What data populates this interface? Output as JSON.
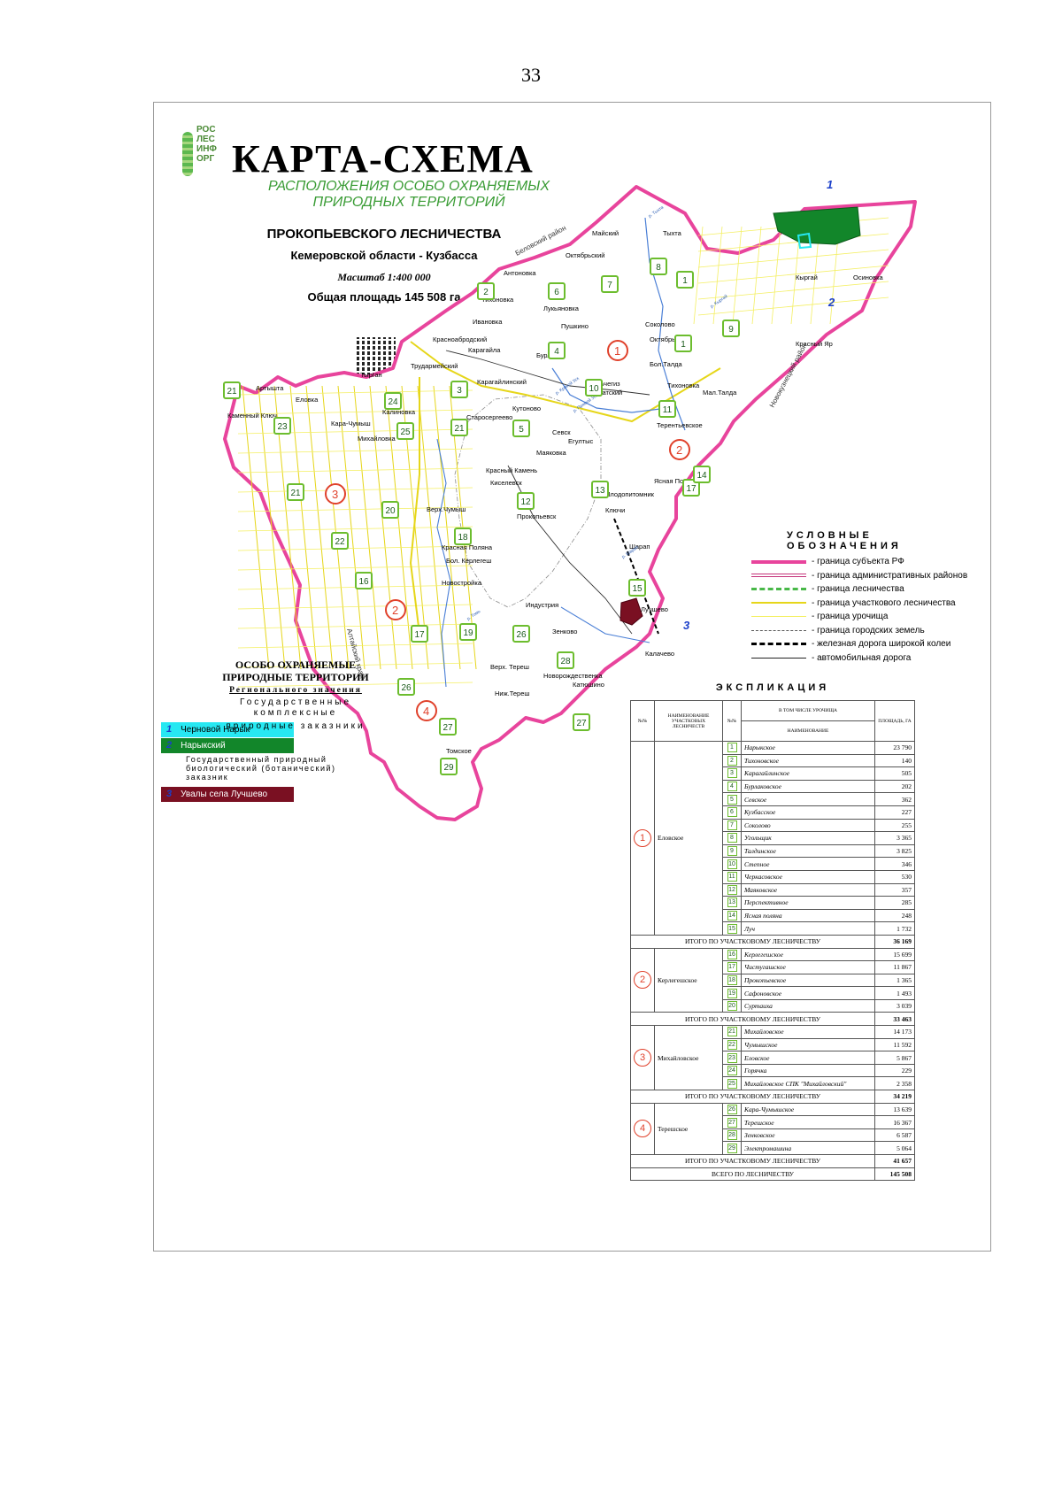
{
  "page_number": "33",
  "header": {
    "logo_text": [
      "РОС",
      "ЛЕС",
      "ИНФ",
      "ОРГ"
    ],
    "title": "КАРТА-СХЕМА",
    "subtitle_line1": "РАСПОЛОЖЕНИЯ ОСОБО ОХРАНЯЕМЫХ",
    "subtitle_line2": "ПРИРОДНЫХ ТЕРРИТОРИЙ",
    "forestry": "ПРОКОПЬЕВСКОГО ЛЕСНИЧЕСТВА",
    "region": "Кемеровской области - Кузбасса",
    "scale": "Масштаб 1:400 000",
    "total_area": "Общая площадь 145 508 га"
  },
  "colors": {
    "subject_border": "#e8449c",
    "district_border": "#c4327a",
    "forestry_border": "#48b848",
    "section_border": "#e6d61a",
    "tract_border": "#f4ef62",
    "green_label": "#6cbd2e",
    "orange_label": "#e0412b",
    "pa_cyan": "#27e8f2",
    "pa_green": "#12862a",
    "pa_maroon": "#7a1022",
    "protected_number": "#1b3fc9"
  },
  "map": {
    "place_names": [
      "Тыхта",
      "Майский",
      "Октябрьский",
      "Антоновка",
      "Тихоновка",
      "Лукьяновка",
      "Ивановка",
      "Пушкино",
      "Соколово",
      "Октябрь",
      "Кыргай",
      "Осиновка",
      "Красный Яр",
      "Бол.Талда",
      "Мал.Талда",
      "Тихоновка",
      "Красноабродский",
      "Карагайла",
      "Бурлаки",
      "Трудармейский",
      "Карагайлинский",
      "Кольчегиз",
      "Тырган",
      "Артышта",
      "Еловка",
      "Каменный Ключ",
      "Калиновка",
      "Кара-Чумыш",
      "Михайловка",
      "Старосергеево",
      "Кутоново",
      "Ускатский",
      "Терентьевское",
      "Егултыс",
      "Севск",
      "Красный Камень",
      "Маяковка",
      "Киселевск",
      "Прокопьевск",
      "Ясная Поляна",
      "Плодопитомник",
      "Ключи",
      "Верх.Чумыш",
      "Красная Поляна",
      "Бол. Керлегеш",
      "Новостройка",
      "Шарап",
      "Лучшево",
      "Индустрия",
      "Зенково",
      "Калачево",
      "Верх. Тереш",
      "Ниж.Тереш",
      "Новорождественка",
      "Катюшино",
      "Томское"
    ],
    "district_labels": [
      "Беловский район",
      "Новокузнецкий район",
      "Алтайский край"
    ],
    "rivers": [
      "р. Томь",
      "р. Кривой Уск",
      "р. Прямой Уск",
      "р. Тыхта",
      "р. Кыргай",
      "р. Шарап"
    ],
    "section_badges": [
      "1",
      "2",
      "3",
      "4"
    ],
    "tract_badges": [
      "1",
      "2",
      "3",
      "4",
      "5",
      "6",
      "7",
      "8",
      "9",
      "10",
      "11",
      "12",
      "13",
      "14",
      "15",
      "16",
      "17",
      "18",
      "19",
      "20",
      "21",
      "22",
      "23",
      "24",
      "25",
      "26",
      "27",
      "28",
      "29"
    ],
    "protected_marks": [
      "1",
      "2",
      "3"
    ]
  },
  "legend": {
    "heading": "УСЛОВНЫЕ ОБОЗНАЧЕНИЯ",
    "items": [
      {
        "label": "- граница субъекта РФ",
        "color": "#e8449c",
        "style": "thick"
      },
      {
        "label": "- граница административных районов",
        "color": "#c4327a",
        "style": "double"
      },
      {
        "label": "- граница лесничества",
        "color": "#48b848",
        "style": "dash"
      },
      {
        "label": "- граница участкового лесничества",
        "color": "#e6d61a",
        "style": "solid"
      },
      {
        "label": "- граница урочища",
        "color": "#f4ef62",
        "style": "thin"
      },
      {
        "label": "- граница городских земель",
        "color": "#555555",
        "style": "dashdot"
      },
      {
        "label": "- железная дорога широкой колеи",
        "color": "#000000",
        "style": "rail"
      },
      {
        "label": "- автомобильная дорога",
        "color": "#222222",
        "style": "road"
      }
    ]
  },
  "protected_areas": {
    "heading_line1": "ОСОБО ОХРАНЯЕМЫЕ",
    "heading_line2": "ПРИРОДНЫЕ ТЕРРИТОРИИ",
    "level": "Регионального значения",
    "category_line1": "Государственные комплексные",
    "category_line2": "природные заказники",
    "items": [
      {
        "num": "1",
        "name": "Черновой Нарык",
        "color": "#27e8f2"
      },
      {
        "num": "2",
        "name": "Нарыкский",
        "color": "#12862a"
      },
      {
        "num": "3",
        "name": "Увалы села Лучшево",
        "color": "#7a1022"
      }
    ],
    "note_line1": "Государственный природный",
    "note_line2": "биологический (ботанический)",
    "note_line3": "заказник"
  },
  "explication": {
    "heading": "ЭКСПЛИКАЦИЯ",
    "headers": {
      "num": "№№",
      "section_name": "НАИМЕНОВАНИЕ УЧАСТКОВЫХ ЛЕСНИЧЕСТВ",
      "num2": "№№",
      "including": "В ТОМ ЧИСЛЕ УРОЧИЩА",
      "tract_name": "НАИМЕНОВАНИЕ",
      "area": "ПЛОЩАДЬ, ГА"
    },
    "sections": [
      {
        "num": "1",
        "name": "Еловское",
        "tracts": [
          {
            "n": "1",
            "name": "Нарыкское",
            "area": "23 790"
          },
          {
            "n": "2",
            "name": "Тихоновское",
            "area": "140"
          },
          {
            "n": "3",
            "name": "Карагайлинское",
            "area": "505"
          },
          {
            "n": "4",
            "name": "Бурлаковское",
            "area": "202"
          },
          {
            "n": "5",
            "name": "Севское",
            "area": "362"
          },
          {
            "n": "6",
            "name": "Кузбасское",
            "area": "227"
          },
          {
            "n": "7",
            "name": "Соколово",
            "area": "255"
          },
          {
            "n": "8",
            "name": "Угольщик",
            "area": "3 365"
          },
          {
            "n": "9",
            "name": "Талдинское",
            "area": "3 825"
          },
          {
            "n": "10",
            "name": "Степное",
            "area": "346"
          },
          {
            "n": "11",
            "name": "Черкасовское",
            "area": "530"
          },
          {
            "n": "12",
            "name": "Маяковское",
            "area": "357"
          },
          {
            "n": "13",
            "name": "Перспективное",
            "area": "285"
          },
          {
            "n": "14",
            "name": "Ясная поляна",
            "area": "248"
          },
          {
            "n": "15",
            "name": "Луч",
            "area": "1 732"
          }
        ],
        "total_label": "ИТОГО ПО УЧАСТКОВОМУ ЛЕСНИЧЕСТВУ",
        "total": "36 169"
      },
      {
        "num": "2",
        "name": "Керлегешское",
        "tracts": [
          {
            "n": "16",
            "name": "Керлегешское",
            "area": "15 699"
          },
          {
            "n": "17",
            "name": "Чистугашское",
            "area": "11 867"
          },
          {
            "n": "18",
            "name": "Прокопьевское",
            "area": "1 365"
          },
          {
            "n": "19",
            "name": "Сафоновское",
            "area": "1 493"
          },
          {
            "n": "20",
            "name": "Суртаиха",
            "area": "3 039"
          }
        ],
        "total_label": "ИТОГО ПО УЧАСТКОВОМУ ЛЕСНИЧЕСТВУ",
        "total": "33 463"
      },
      {
        "num": "3",
        "name": "Михайловское",
        "tracts": [
          {
            "n": "21",
            "name": "Михайловское",
            "area": "14 173"
          },
          {
            "n": "22",
            "name": "Чумышское",
            "area": "11 592"
          },
          {
            "n": "23",
            "name": "Еловское",
            "area": "5 867"
          },
          {
            "n": "24",
            "name": "Горячка",
            "area": "229"
          },
          {
            "n": "25",
            "name": "Михайловское СПК \"Михайловский\"",
            "area": "2 358"
          }
        ],
        "total_label": "ИТОГО ПО УЧАСТКОВОМУ ЛЕСНИЧЕСТВУ",
        "total": "34 219"
      },
      {
        "num": "4",
        "name": "Терешское",
        "tracts": [
          {
            "n": "26",
            "name": "Кара-Чумышское",
            "area": "13 639"
          },
          {
            "n": "27",
            "name": "Терешское",
            "area": "16 367"
          },
          {
            "n": "28",
            "name": "Зенковское",
            "area": "6 587"
          },
          {
            "n": "29",
            "name": "Электромашина",
            "area": "5 064"
          }
        ],
        "total_label": "ИТОГО ПО УЧАСТКОВОМУ ЛЕСНИЧЕСТВУ",
        "total": "41 657"
      }
    ],
    "grand_total_label": "ВСЕГО ПО ЛЕСНИЧЕСТВУ",
    "grand_total": "145 508"
  }
}
